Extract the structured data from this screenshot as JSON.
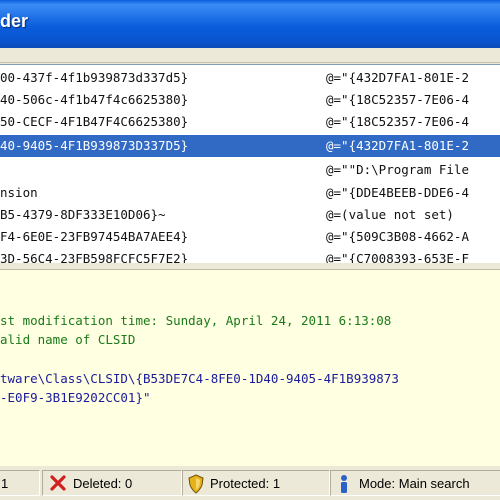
{
  "window": {
    "title_fragment": "der"
  },
  "list_rows": [
    {
      "name": "00-437f-4f1b939873d337d5}",
      "data": "@=\"{432D7FA1-801E-2"
    },
    {
      "name": "40-506c-4f1b47f4c6625380}",
      "data": "@=\"{18C52357-7E06-4"
    },
    {
      "name": "50-CECF-4F1B47F4C6625380}",
      "data": "@=\"{18C52357-7E06-4"
    },
    {
      "name": "40-9405-4F1B939873D337D5}",
      "data": "@=\"{432D7FA1-801E-2",
      "selected": true
    },
    {
      "name": "",
      "data": "@=\"\"D:\\Program File"
    },
    {
      "name": "nsion",
      "data": "@=\"{DDE4BEEB-DDE6-4"
    },
    {
      "name": "B5-4379-8DF333E10D06}~",
      "data": "@=(value not set)"
    },
    {
      "name": "F4-6E0E-23FB97454BA7AEE4}",
      "data": "@=\"{509C3B08-4662-A"
    },
    {
      "name": "3D-56C4-23FB598FCFC5F7E2}",
      "data": "@=\"{C7008393-653E-F"
    }
  ],
  "detail": {
    "line1": "st modification time: Sunday, April 24, 2011 6:13:08",
    "line2": "alid name of CLSID",
    "line3": "tware\\Class\\CLSID\\{B53DE7C4-8FE0-1D40-9405-4F1B939873",
    "line4": "-E0F9-3B1E9202CC01}\""
  },
  "status": {
    "count": "1",
    "deleted": "Deleted: 0",
    "protected": "Protected: 1",
    "mode": "Mode: Main search"
  },
  "colors": {
    "titlebar": "#0b5ddc",
    "selection": "#316ac5",
    "detail_bg": "#ffffe1",
    "green_text": "#1a7a1a",
    "blue_text": "#1b1b9c"
  },
  "icons": {
    "deleted": "red-x-icon",
    "protected": "shield-icon",
    "mode": "info-person-icon"
  }
}
